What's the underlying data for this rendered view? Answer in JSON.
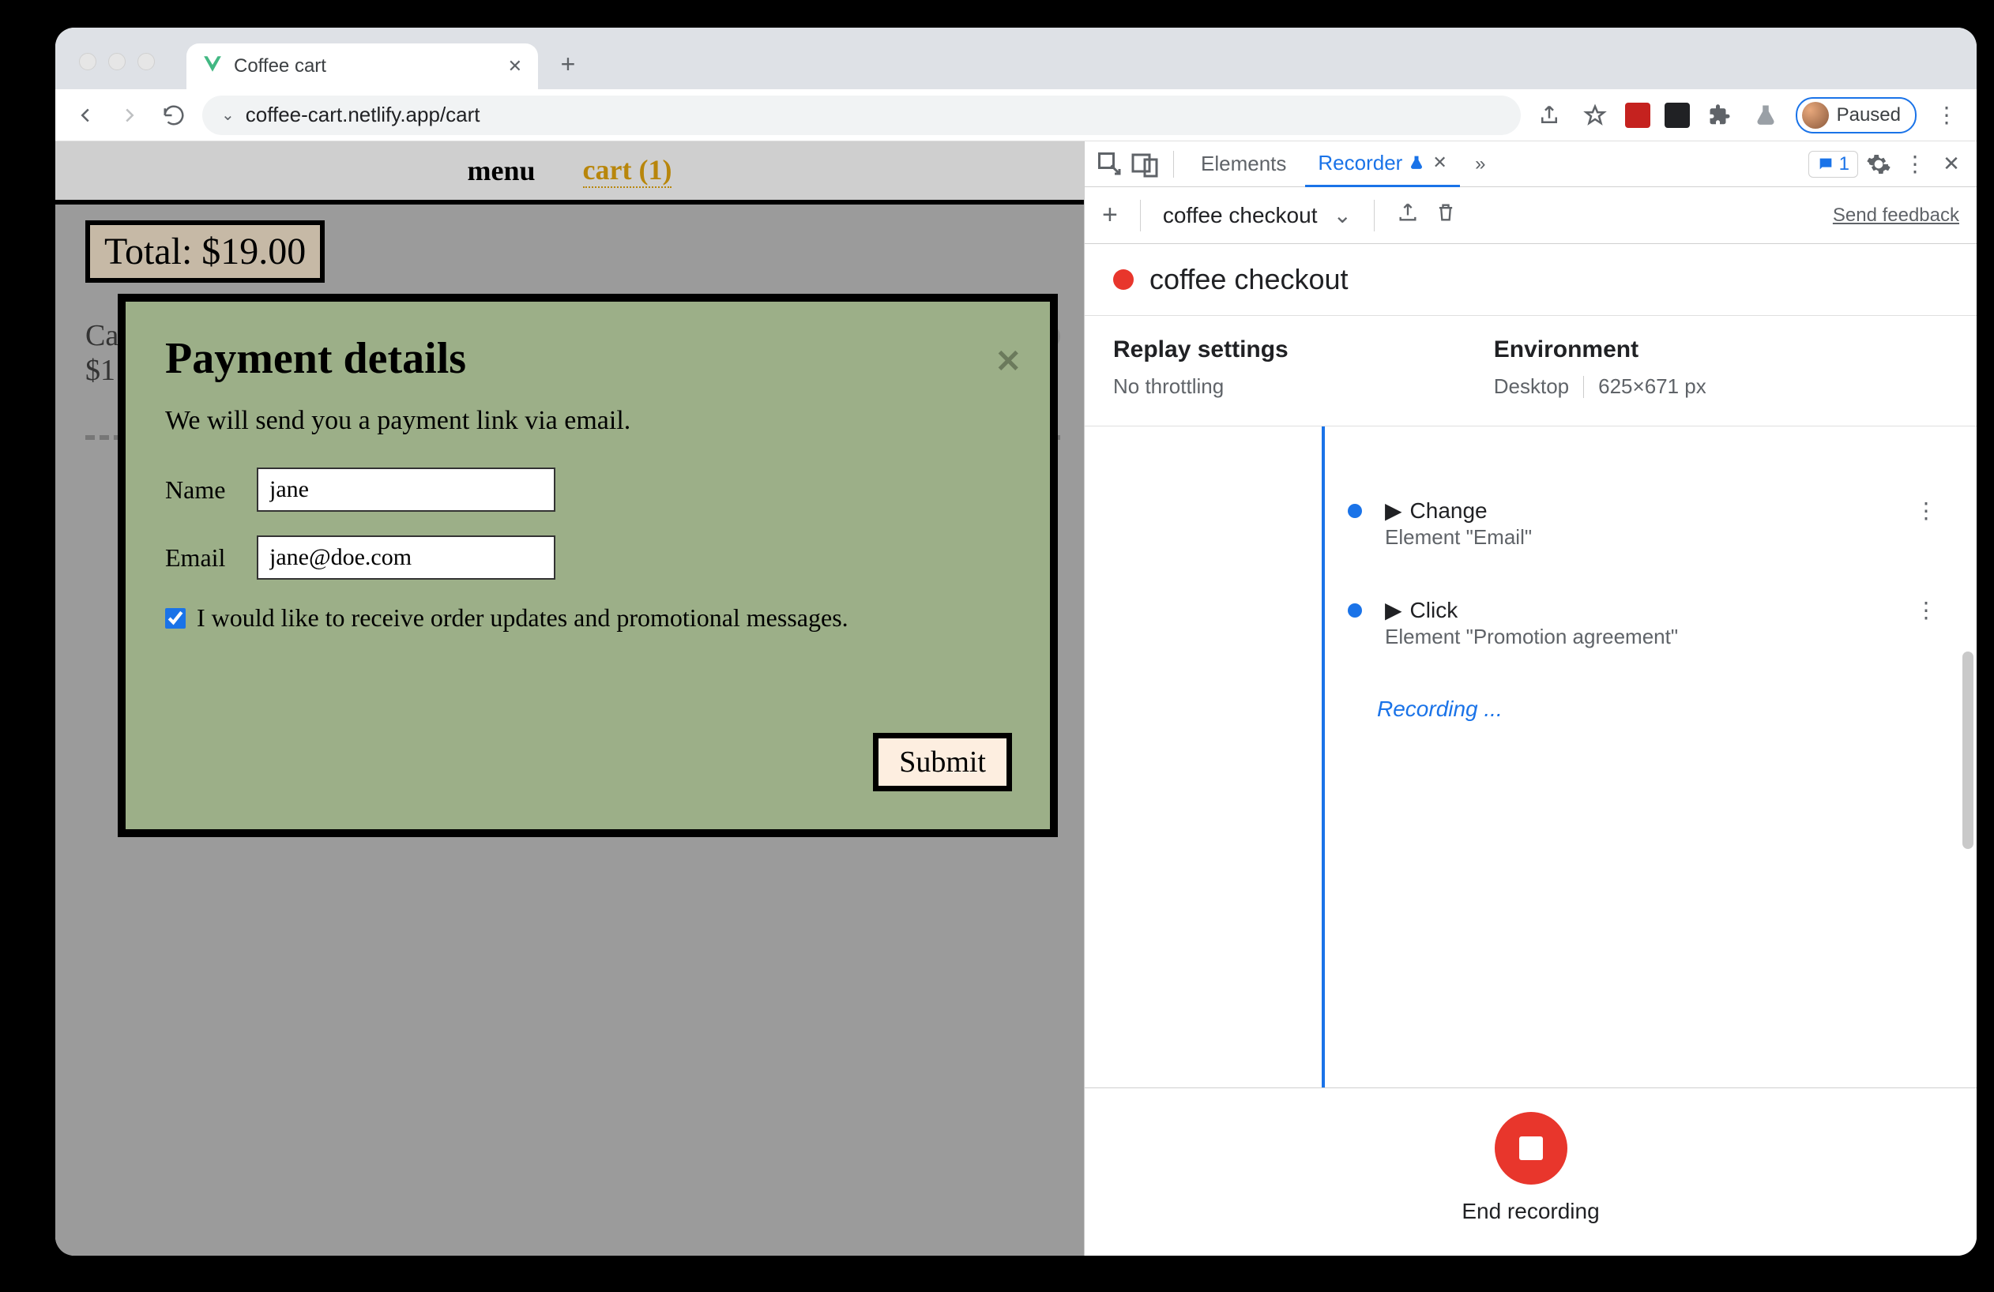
{
  "browser": {
    "tab_title": "Coffee cart",
    "url": "coffee-cart.netlify.app/cart",
    "profile_status": "Paused"
  },
  "app": {
    "nav": {
      "menu": "menu",
      "cart": "cart (1)"
    },
    "total": "Total: $19.00",
    "cart_item": {
      "name_prefix": "Ca",
      "price_suffix": "00",
      "price_label": "$1"
    },
    "modal": {
      "title": "Payment details",
      "subtitle": "We will send you a payment link via email.",
      "name_label": "Name",
      "name_value": "jane",
      "email_label": "Email",
      "email_value": "jane@doe.com",
      "promo_label": "I would like to receive order updates and promotional messages.",
      "submit": "Submit"
    }
  },
  "devtools": {
    "tabs": {
      "elements": "Elements",
      "recorder": "Recorder"
    },
    "issues_count": "1",
    "toolbar": {
      "recording_name": "coffee checkout",
      "send_feedback": "Send feedback"
    },
    "title": "coffee checkout",
    "settings": {
      "replay_label": "Replay settings",
      "replay_value": "No throttling",
      "env_label": "Environment",
      "env_device": "Desktop",
      "env_dims": "625×671 px"
    },
    "steps": [
      {
        "action": "Change",
        "target": "Element \"Email\""
      },
      {
        "action": "Click",
        "target": "Element \"Promotion agreement\""
      }
    ],
    "recording_status": "Recording ...",
    "end_label": "End recording"
  }
}
